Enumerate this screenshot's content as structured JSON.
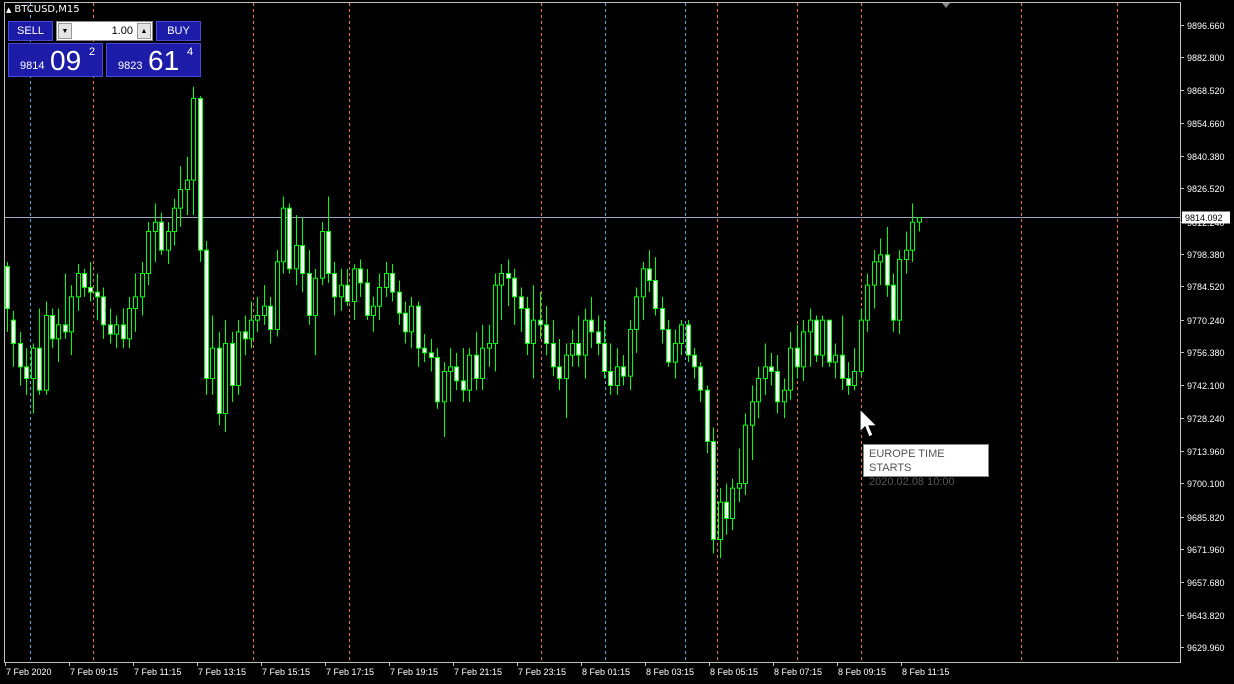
{
  "header": {
    "symbol_label": "BTCUSD,M15"
  },
  "trade_panel": {
    "sell_label": "SELL",
    "buy_label": "BUY",
    "lot_value": "1.00",
    "sell_price": {
      "prefix": "9814",
      "big": "09",
      "sup": "2"
    },
    "buy_price": {
      "prefix": "9823",
      "big": "61",
      "sup": "4"
    }
  },
  "current_price_label": "9814.092",
  "tooltip": {
    "title": "EUROPE TIME STARTS",
    "date": "2020.02.08 10:00"
  },
  "colors": {
    "bull": "#00ff00",
    "bear": "#ffffff",
    "wick": "#00ff00",
    "grid_orange": "#e87a3a",
    "grid_blue": "#5aa8e0",
    "price_line": "#9aa8c0"
  },
  "chart_data": {
    "type": "candlestick",
    "ylim": [
      9623.5,
      9905.5
    ],
    "y_ticks": [
      "9896.660",
      "9882.800",
      "9868.520",
      "9854.660",
      "9840.380",
      "9826.520",
      "9812.240",
      "9798.380",
      "9784.520",
      "9770.240",
      "9756.380",
      "9742.100",
      "9728.240",
      "9713.960",
      "9700.100",
      "9685.820",
      "9671.960",
      "9657.680",
      "9643.820",
      "9629.960"
    ],
    "x_labels": [
      "7 Feb 2020",
      "7 Feb 09:15",
      "7 Feb 11:15",
      "7 Feb 13:15",
      "7 Feb 15:15",
      "7 Feb 17:15",
      "7 Feb 19:15",
      "7 Feb 21:15",
      "7 Feb 23:15",
      "8 Feb 01:15",
      "8 Feb 03:15",
      "8 Feb 05:15",
      "8 Feb 07:15",
      "8 Feb 09:15",
      "8 Feb 11:15"
    ],
    "session_lines": [
      {
        "label": "7 Feb 08:00",
        "color": "blue"
      },
      {
        "label": "7 Feb 09:00",
        "color": "orange"
      },
      {
        "label": "7 Feb 14:00",
        "color": "orange"
      },
      {
        "label": "7 Feb 17:00",
        "color": "orange"
      },
      {
        "label": "7 Feb 23:00",
        "color": "orange"
      },
      {
        "label": "8 Feb 01:00",
        "color": "blue"
      },
      {
        "label": "8 Feb 04:00",
        "color": "blue"
      },
      {
        "label": "8 Feb 05:00",
        "color": "orange"
      },
      {
        "label": "8 Feb 08:00",
        "color": "orange"
      },
      {
        "label": "8 Feb 10:00",
        "color": "orange"
      },
      {
        "label": "8 Feb 15:00",
        "color": "orange"
      },
      {
        "label": "8 Feb 18:00",
        "color": "orange"
      }
    ],
    "current_price": 9814.092,
    "candles": [
      [
        9793,
        9795,
        9765,
        9775
      ],
      [
        9770,
        9774,
        9750,
        9760
      ],
      [
        9760,
        9765,
        9742,
        9750
      ],
      [
        9750,
        9758,
        9738,
        9745
      ],
      [
        9745,
        9760,
        9730,
        9758
      ],
      [
        9758,
        9775,
        9738,
        9740
      ],
      [
        9740,
        9778,
        9738,
        9772
      ],
      [
        9772,
        9775,
        9758,
        9762
      ],
      [
        9762,
        9775,
        9752,
        9768
      ],
      [
        9768,
        9790,
        9762,
        9765
      ],
      [
        9765,
        9785,
        9755,
        9780
      ],
      [
        9780,
        9794,
        9774,
        9790
      ],
      [
        9790,
        9792,
        9780,
        9784
      ],
      [
        9784,
        9795,
        9778,
        9782
      ],
      [
        9782,
        9790,
        9770,
        9780
      ],
      [
        9780,
        9784,
        9762,
        9768
      ],
      [
        9768,
        9775,
        9760,
        9764
      ],
      [
        9764,
        9772,
        9758,
        9768
      ],
      [
        9768,
        9775,
        9758,
        9762
      ],
      [
        9762,
        9780,
        9758,
        9775
      ],
      [
        9775,
        9790,
        9765,
        9780
      ],
      [
        9780,
        9795,
        9772,
        9790
      ],
      [
        9790,
        9812,
        9785,
        9808
      ],
      [
        9808,
        9820,
        9795,
        9812
      ],
      [
        9812,
        9816,
        9798,
        9800
      ],
      [
        9800,
        9812,
        9794,
        9808
      ],
      [
        9808,
        9822,
        9802,
        9818
      ],
      [
        9818,
        9836,
        9810,
        9826
      ],
      [
        9826,
        9840,
        9815,
        9830
      ],
      [
        9830,
        9870,
        9815,
        9865
      ],
      [
        9865,
        9866,
        9795,
        9800
      ],
      [
        9800,
        9804,
        9738,
        9745
      ],
      [
        9745,
        9772,
        9738,
        9758
      ],
      [
        9758,
        9765,
        9725,
        9730
      ],
      [
        9730,
        9770,
        9722,
        9760
      ],
      [
        9760,
        9765,
        9735,
        9742
      ],
      [
        9742,
        9770,
        9738,
        9765
      ],
      [
        9765,
        9772,
        9755,
        9762
      ],
      [
        9762,
        9778,
        9758,
        9770
      ],
      [
        9770,
        9780,
        9765,
        9772
      ],
      [
        9772,
        9785,
        9768,
        9776
      ],
      [
        9776,
        9780,
        9760,
        9766
      ],
      [
        9766,
        9800,
        9763,
        9795
      ],
      [
        9795,
        9823,
        9790,
        9818
      ],
      [
        9818,
        9820,
        9790,
        9792
      ],
      [
        9792,
        9815,
        9785,
        9802
      ],
      [
        9802,
        9814,
        9782,
        9790
      ],
      [
        9790,
        9800,
        9768,
        9772
      ],
      [
        9772,
        9792,
        9755,
        9788
      ],
      [
        9788,
        9812,
        9785,
        9808
      ],
      [
        9808,
        9823,
        9786,
        9790
      ],
      [
        9790,
        9795,
        9772,
        9780
      ],
      [
        9780,
        9792,
        9774,
        9785
      ],
      [
        9785,
        9792,
        9776,
        9778
      ],
      [
        9778,
        9794,
        9770,
        9792
      ],
      [
        9792,
        9796,
        9780,
        9786
      ],
      [
        9786,
        9792,
        9770,
        9772
      ],
      [
        9772,
        9780,
        9765,
        9776
      ],
      [
        9776,
        9790,
        9770,
        9784
      ],
      [
        9784,
        9795,
        9780,
        9790
      ],
      [
        9790,
        9794,
        9778,
        9782
      ],
      [
        9782,
        9787,
        9768,
        9773
      ],
      [
        9773,
        9778,
        9760,
        9765
      ],
      [
        9765,
        9780,
        9758,
        9776
      ],
      [
        9776,
        9778,
        9750,
        9758
      ],
      [
        9758,
        9764,
        9752,
        9756
      ],
      [
        9756,
        9762,
        9748,
        9754
      ],
      [
        9754,
        9758,
        9732,
        9735
      ],
      [
        9735,
        9752,
        9720,
        9748
      ],
      [
        9748,
        9758,
        9735,
        9750
      ],
      [
        9750,
        9756,
        9740,
        9744
      ],
      [
        9744,
        9758,
        9735,
        9740
      ],
      [
        9740,
        9758,
        9735,
        9755
      ],
      [
        9755,
        9765,
        9740,
        9745
      ],
      [
        9745,
        9768,
        9740,
        9758
      ],
      [
        9758,
        9768,
        9750,
        9760
      ],
      [
        9760,
        9790,
        9748,
        9785
      ],
      [
        9785,
        9794,
        9770,
        9790
      ],
      [
        9790,
        9796,
        9776,
        9788
      ],
      [
        9788,
        9792,
        9768,
        9780
      ],
      [
        9780,
        9784,
        9765,
        9775
      ],
      [
        9775,
        9780,
        9755,
        9760
      ],
      [
        9760,
        9785,
        9745,
        9770
      ],
      [
        9770,
        9782,
        9762,
        9768
      ],
      [
        9768,
        9776,
        9755,
        9760
      ],
      [
        9760,
        9770,
        9746,
        9750
      ],
      [
        9750,
        9762,
        9740,
        9745
      ],
      [
        9745,
        9760,
        9728,
        9755
      ],
      [
        9755,
        9766,
        9750,
        9760
      ],
      [
        9760,
        9772,
        9750,
        9755
      ],
      [
        9755,
        9775,
        9745,
        9770
      ],
      [
        9770,
        9780,
        9758,
        9765
      ],
      [
        9765,
        9772,
        9755,
        9760
      ],
      [
        9760,
        9770,
        9745,
        9748
      ],
      [
        9748,
        9760,
        9738,
        9742
      ],
      [
        9742,
        9758,
        9738,
        9750
      ],
      [
        9750,
        9755,
        9742,
        9746
      ],
      [
        9746,
        9770,
        9740,
        9766
      ],
      [
        9766,
        9784,
        9756,
        9780
      ],
      [
        9780,
        9795,
        9770,
        9792
      ],
      [
        9792,
        9800,
        9782,
        9787
      ],
      [
        9787,
        9797,
        9772,
        9775
      ],
      [
        9775,
        9780,
        9760,
        9766
      ],
      [
        9766,
        9770,
        9750,
        9752
      ],
      [
        9752,
        9766,
        9745,
        9760
      ],
      [
        9760,
        9770,
        9755,
        9768
      ],
      [
        9768,
        9770,
        9752,
        9755
      ],
      [
        9755,
        9758,
        9745,
        9750
      ],
      [
        9750,
        9752,
        9735,
        9740
      ],
      [
        9740,
        9742,
        9713,
        9718
      ],
      [
        9718,
        9724,
        9670,
        9676
      ],
      [
        9676,
        9698,
        9668,
        9692
      ],
      [
        9692,
        9700,
        9678,
        9685
      ],
      [
        9685,
        9702,
        9680,
        9698
      ],
      [
        9698,
        9715,
        9692,
        9700
      ],
      [
        9700,
        9730,
        9695,
        9725
      ],
      [
        9725,
        9742,
        9710,
        9735
      ],
      [
        9735,
        9750,
        9728,
        9745
      ],
      [
        9745,
        9760,
        9738,
        9750
      ],
      [
        9750,
        9756,
        9742,
        9748
      ],
      [
        9748,
        9755,
        9730,
        9735
      ],
      [
        9735,
        9745,
        9728,
        9740
      ],
      [
        9740,
        9765,
        9736,
        9758
      ],
      [
        9758,
        9768,
        9745,
        9750
      ],
      [
        9750,
        9770,
        9744,
        9765
      ],
      [
        9765,
        9775,
        9750,
        9770
      ],
      [
        9770,
        9772,
        9752,
        9755
      ],
      [
        9755,
        9772,
        9750,
        9770
      ],
      [
        9770,
        9768,
        9750,
        9752
      ],
      [
        9752,
        9760,
        9745,
        9755
      ],
      [
        9755,
        9772,
        9740,
        9745
      ],
      [
        9745,
        9752,
        9738,
        9742
      ],
      [
        9742,
        9758,
        9740,
        9748
      ],
      [
        9748,
        9775,
        9746,
        9770
      ],
      [
        9770,
        9790,
        9765,
        9785
      ],
      [
        9785,
        9800,
        9775,
        9795
      ],
      [
        9795,
        9805,
        9785,
        9798
      ],
      [
        9798,
        9810,
        9780,
        9785
      ],
      [
        9785,
        9790,
        9765,
        9770
      ],
      [
        9770,
        9800,
        9764,
        9796
      ],
      [
        9796,
        9808,
        9790,
        9800
      ],
      [
        9800,
        9820,
        9795,
        9812
      ],
      [
        9812,
        9814,
        9808,
        9814
      ]
    ]
  }
}
